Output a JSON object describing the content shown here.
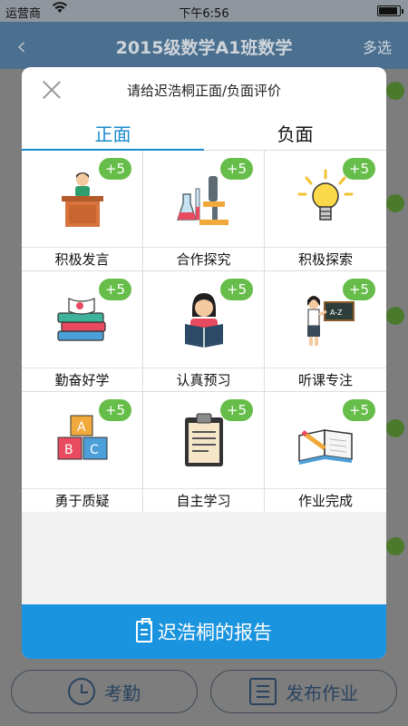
{
  "status_bar": {
    "carrier": "运营商",
    "time": "下午6:56"
  },
  "nav": {
    "back": "‹",
    "title": "2015级数学A1班数学",
    "multi_select": "多选"
  },
  "bottom_bar": {
    "attendance": "考勤",
    "publish_homework": "发布作业"
  },
  "modal": {
    "title": "请给迟浩桐正面/负面评价",
    "tabs": [
      {
        "label": "正面",
        "active": true
      },
      {
        "label": "负面",
        "active": false
      }
    ],
    "items": [
      {
        "label": "积极发言",
        "points": "+5",
        "icon": "podium-speaker-icon"
      },
      {
        "label": "合作探究",
        "points": "+5",
        "icon": "microscope-flask-icon"
      },
      {
        "label": "积极探索",
        "points": "+5",
        "icon": "lightbulb-icon"
      },
      {
        "label": "勤奋好学",
        "points": "+5",
        "icon": "book-stack-icon"
      },
      {
        "label": "认真预习",
        "points": "+5",
        "icon": "reading-student-icon"
      },
      {
        "label": "听课专注",
        "points": "+5",
        "icon": "teacher-board-icon"
      },
      {
        "label": "勇于质疑",
        "points": "+5",
        "icon": "abc-blocks-icon"
      },
      {
        "label": "自主学习",
        "points": "+5",
        "icon": "clipboard-icon"
      },
      {
        "label": "作业完成",
        "points": "+5",
        "icon": "open-book-pencil-icon"
      }
    ],
    "footer": "迟浩桐的报告"
  },
  "colors": {
    "accent": "#1b94df",
    "tab_active": "#1b8bd0",
    "points_badge": "#66bd4a"
  }
}
